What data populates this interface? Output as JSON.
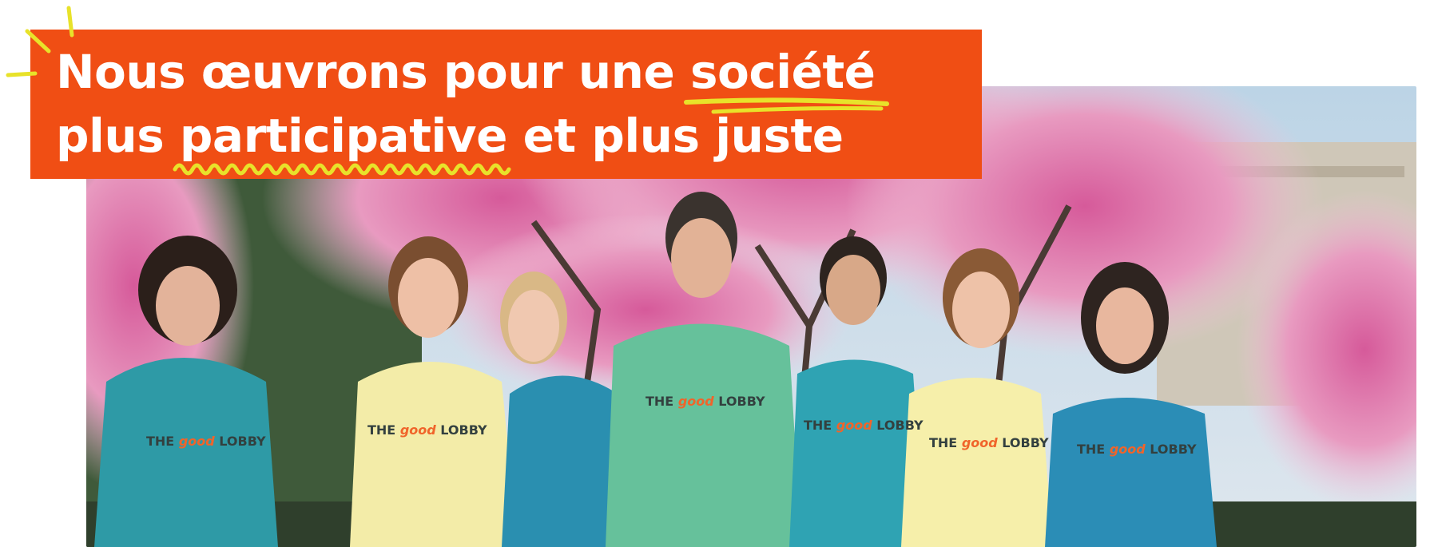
{
  "theme": {
    "accent": "#f04e14",
    "highlight": "#e8e22a",
    "text": "#ffffff"
  },
  "hero": {
    "headline": {
      "line1_pre": "Nous œuvrons pour une ",
      "line1_highlight": "société",
      "line2_pre": "plus ",
      "line2_highlight": "participative",
      "line2_post": " et plus juste"
    },
    "decorations": {
      "spark": "spark-lines-icon",
      "straight_underline": "straight-underline-stroke",
      "wavy_underline": "wavy-underline-stroke"
    },
    "photo": {
      "hoodie_print": {
        "part1": "THE",
        "part2": "good",
        "part3": "LOBBY"
      }
    }
  }
}
